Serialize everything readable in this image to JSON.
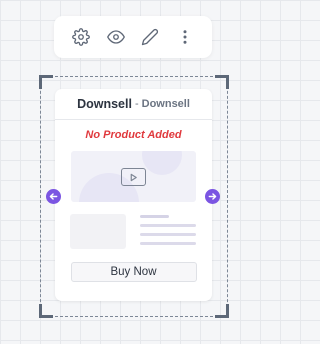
{
  "toolbar": {
    "icons": [
      "gear-icon",
      "eye-icon",
      "pencil-icon",
      "more-vertical-icon"
    ]
  },
  "card": {
    "title": "Downsell",
    "separator": "-",
    "subtitle": "Downsell",
    "empty_message": "No Product Added",
    "buy_button_label": "Buy Now"
  },
  "colors": {
    "accent": "#7b55e2",
    "error": "#e03a3e",
    "text": "#2d3440",
    "muted": "#6b7482"
  }
}
